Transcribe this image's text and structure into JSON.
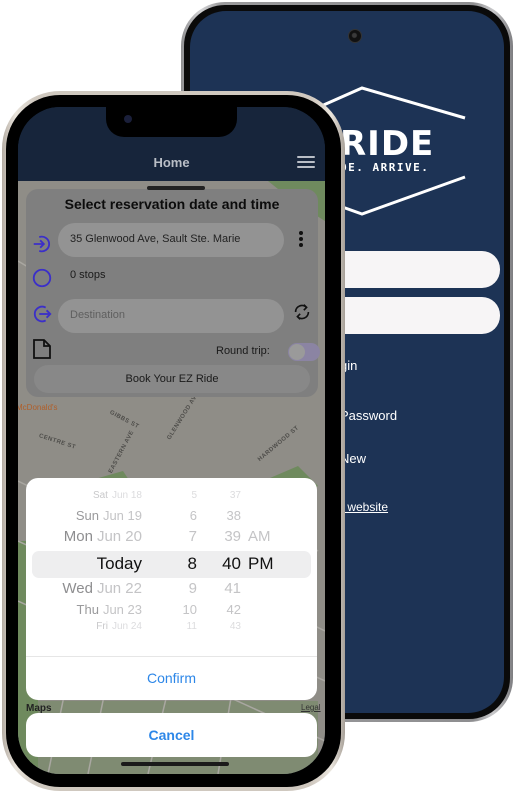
{
  "login_app": {
    "logo_word": "RIDE",
    "logo_tagline": "DE. ARRIVE.",
    "links": {
      "login": "gin",
      "forgot_password": "Password",
      "new_account": "New",
      "website": "r website"
    },
    "colors": {
      "background": "#1d3355",
      "input": "#f7f5f6"
    }
  },
  "main_app": {
    "nav": {
      "title": "Home",
      "menu_icon": "hamburger-menu-icon"
    },
    "reservation_card": {
      "title": "Select reservation date and time",
      "pickup_address": "35 Glenwood Ave, Sault Ste. Marie",
      "stops_label": "0 stops",
      "destination_placeholder": "Destination",
      "round_trip_label": "Round trip:",
      "round_trip_enabled": false,
      "book_button": "Book Your EZ Ride",
      "icons": {
        "pickup": "login-arrow-icon",
        "stops": "circle-icon",
        "destination": "logout-arrow-icon",
        "more": "more-vertical-icon",
        "swap": "swap-arrows-icon",
        "note": "document-icon"
      }
    },
    "map": {
      "street_labels": [
        "GIBBS ST",
        "CENTRE ST",
        "EASTERN AVE",
        "GLENWOOD AVE",
        "HARDWOOD ST"
      ],
      "poi": "McDonald's",
      "attribution": "Maps",
      "legal": "Legal"
    },
    "date_picker": {
      "rows": [
        {
          "weekday": "Sat",
          "date": "Jun 18",
          "hour": "5",
          "minute": "37",
          "ampm": ""
        },
        {
          "weekday": "Sun",
          "date": "Jun 19",
          "hour": "6",
          "minute": "38",
          "ampm": ""
        },
        {
          "weekday": "Mon",
          "date": "Jun 20",
          "hour": "7",
          "minute": "39",
          "ampm": "AM"
        },
        {
          "weekday": "Today",
          "date": "",
          "hour": "8",
          "minute": "40",
          "ampm": "PM"
        },
        {
          "weekday": "Wed",
          "date": "Jun 22",
          "hour": "9",
          "minute": "41",
          "ampm": ""
        },
        {
          "weekday": "Thu",
          "date": "Jun 23",
          "hour": "10",
          "minute": "42",
          "ampm": ""
        },
        {
          "weekday": "Fri",
          "date": "Jun 24",
          "hour": "11",
          "minute": "43",
          "ampm": ""
        }
      ],
      "selected_index": 3
    },
    "actions": {
      "confirm": "Confirm",
      "cancel": "Cancel"
    },
    "colors": {
      "accent_blue": "#2d87e8",
      "icon_purple": "#3b2fc9",
      "nav_bg": "#17253b"
    }
  }
}
